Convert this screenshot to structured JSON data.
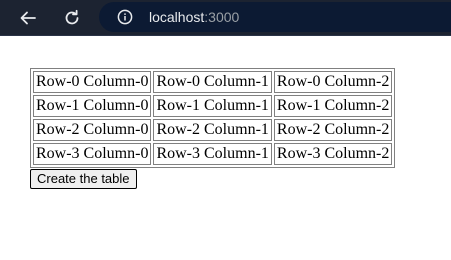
{
  "browser": {
    "url_host": "localhost",
    "url_port": ":3000"
  },
  "table": {
    "rows": [
      [
        "Row-0 Column-0",
        "Row-0 Column-1",
        "Row-0 Column-2"
      ],
      [
        "Row-1 Column-0",
        "Row-1 Column-1",
        "Row-1 Column-2"
      ],
      [
        "Row-2 Column-0",
        "Row-2 Column-1",
        "Row-2 Column-2"
      ],
      [
        "Row-3 Column-0",
        "Row-3 Column-1",
        "Row-3 Column-2"
      ]
    ]
  },
  "actions": {
    "create_label": "Create the table"
  }
}
